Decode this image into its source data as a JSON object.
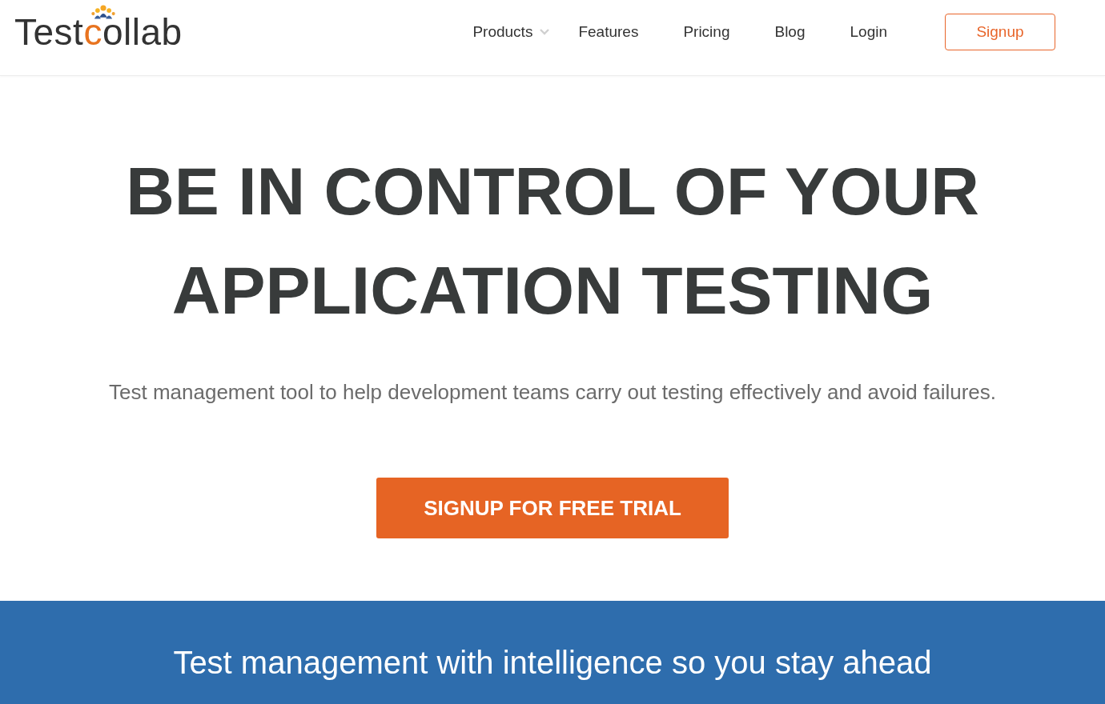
{
  "header": {
    "logo": [
      {
        "text": "Test",
        "accent": false
      },
      {
        "text": "c",
        "accent": true
      },
      {
        "text": "ollab",
        "accent": false
      }
    ],
    "nav": [
      {
        "label": "Products",
        "dropdown": true
      },
      {
        "label": "Features",
        "dropdown": false
      },
      {
        "label": "Pricing",
        "dropdown": false
      },
      {
        "label": "Blog",
        "dropdown": false
      },
      {
        "label": "Login",
        "dropdown": false
      }
    ],
    "signup_button": {
      "label": "Signup"
    }
  },
  "hero": {
    "title": "BE IN CONTROL OF YOUR APPLICATION TESTING",
    "subtitle": "Test management tool to help development teams carry out testing effectively and avoid failures.",
    "cta": {
      "label": "SIGNUP FOR FREE TRIAL"
    }
  },
  "banner": {
    "text": "Test management with intelligence so you stay ahead"
  }
}
